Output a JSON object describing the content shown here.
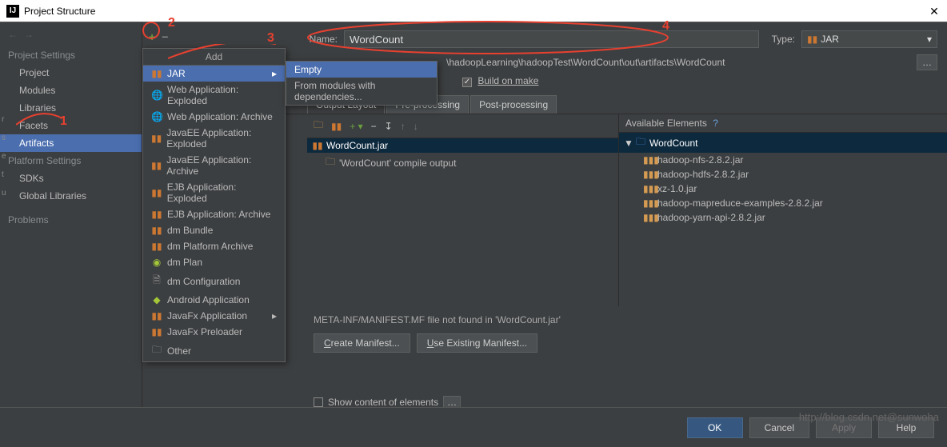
{
  "window": {
    "title": "Project Structure"
  },
  "sidebar": {
    "group1_title": "Project Settings",
    "items1": [
      "Project",
      "Modules",
      "Libraries",
      "Facets",
      "Artifacts"
    ],
    "group2_title": "Platform Settings",
    "items2": [
      "SDKs",
      "Global Libraries"
    ],
    "group3_title": "Problems"
  },
  "header": {
    "name_label": "Name:",
    "name_value": "WordCount",
    "type_label": "Type:",
    "type_value": "JAR",
    "output_path": "\\hadoopLearning\\hadoopTest\\WordCount\\out\\artifacts\\WordCount",
    "build_on_make": "Build on make"
  },
  "tabs": {
    "t1": "Output Layout",
    "t2": "Pre-processing",
    "t3": "Post-processing"
  },
  "tree_left": {
    "root": "WordCount.jar",
    "child1": "'WordCount' compile output"
  },
  "available": {
    "header": "Available Elements",
    "root": "WordCount",
    "libs": [
      "hadoop-nfs-2.8.2.jar",
      "hadoop-hdfs-2.8.2.jar",
      "xz-1.0.jar",
      "hadoop-mapreduce-examples-2.8.2.jar",
      "hadoop-yarn-api-2.8.2.jar"
    ]
  },
  "manifest": {
    "message": "META-INF/MANIFEST.MF file not found in 'WordCount.jar'",
    "create_btn": "Create Manifest...",
    "use_btn": "Use Existing Manifest..."
  },
  "show_content": "Show content of elements",
  "footer": {
    "ok": "OK",
    "cancel": "Cancel",
    "apply": "Apply",
    "help": "Help"
  },
  "popup": {
    "header": "Add",
    "items": [
      "JAR",
      "Web Application: Exploded",
      "Web Application: Archive",
      "JavaEE Application: Exploded",
      "JavaEE Application: Archive",
      "EJB Application: Exploded",
      "EJB Application: Archive",
      "dm Bundle",
      "dm Platform Archive",
      "dm Plan",
      "dm Configuration",
      "Android Application",
      "JavaFx Application",
      "JavaFx Preloader",
      "Other"
    ]
  },
  "sub_popup": {
    "item1": "Empty",
    "item2": "From modules with dependencies..."
  },
  "watermark": "http://blog.csdn.net@sunwoha",
  "annotations": {
    "n1": "1",
    "n2": "2",
    "n3": "3",
    "n4": "4"
  }
}
